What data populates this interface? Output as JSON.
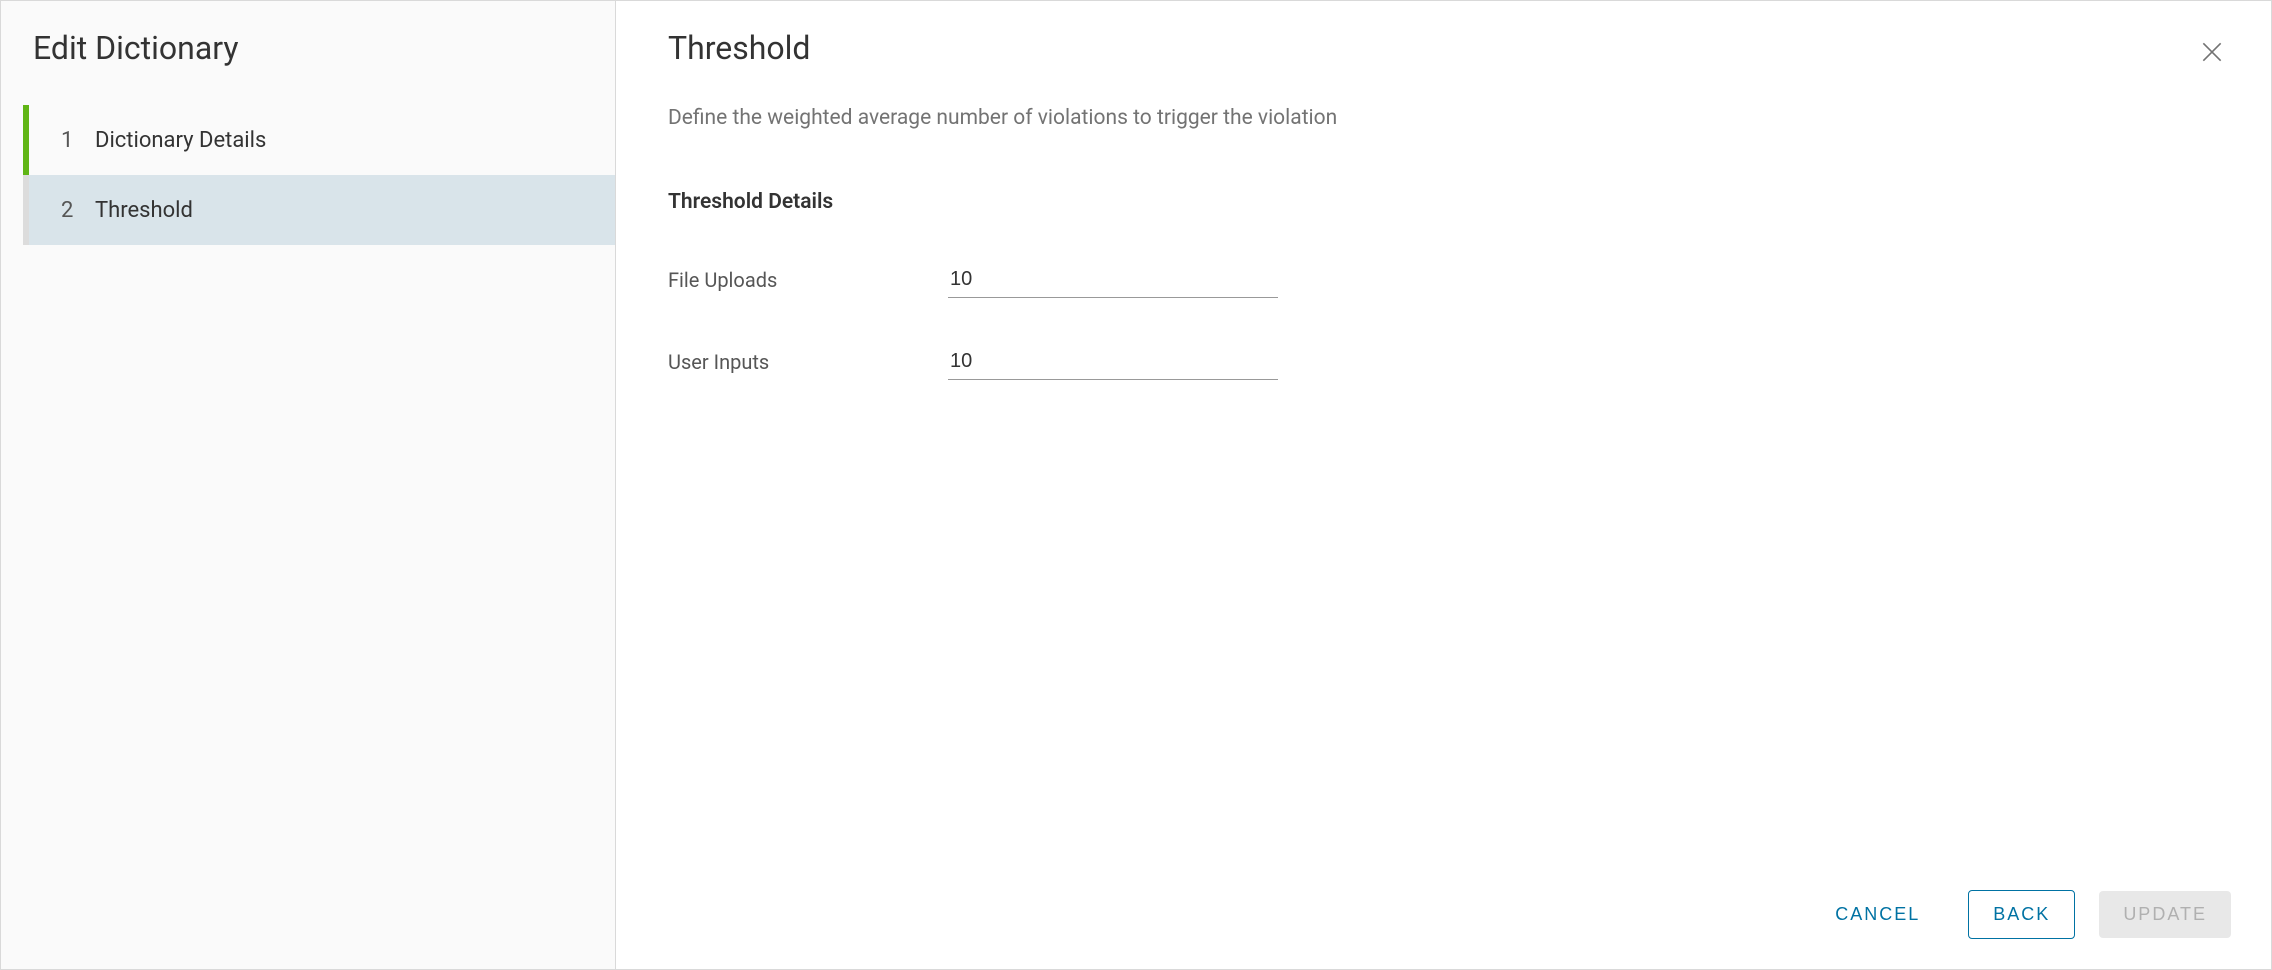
{
  "sidebar": {
    "title": "Edit Dictionary",
    "steps": [
      {
        "num": "1",
        "label": "Dictionary Details"
      },
      {
        "num": "2",
        "label": "Threshold"
      }
    ]
  },
  "main": {
    "title": "Threshold",
    "description": "Define the weighted average number of violations to trigger the violation",
    "section_title": "Threshold Details",
    "fields": {
      "file_uploads": {
        "label": "File Uploads",
        "value": "10"
      },
      "user_inputs": {
        "label": "User Inputs",
        "value": "10"
      }
    }
  },
  "footer": {
    "cancel": "CANCEL",
    "back": "BACK",
    "update": "UPDATE"
  }
}
